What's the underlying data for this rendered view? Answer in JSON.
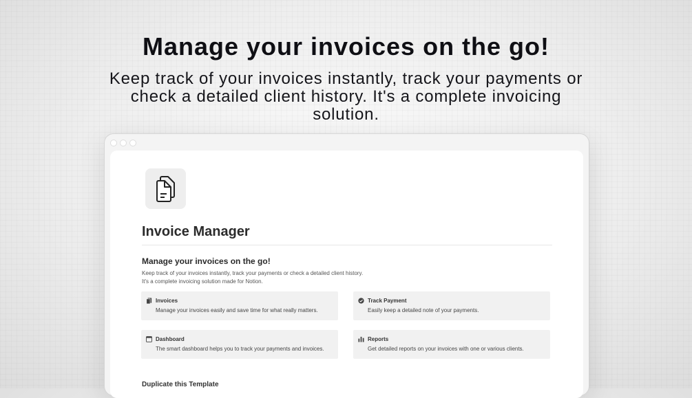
{
  "hero": {
    "title": "Manage your invoices on the go!",
    "subtitle": "Keep track of your invoices instantly, track your payments or check a detailed client history. It's a complete invoicing solution."
  },
  "page": {
    "icon": "document-copy-icon",
    "title": "Invoice Manager",
    "section_heading": "Manage your invoices on the go!",
    "description_line1": "Keep track of your invoices instantly, track your payments or check a detailed client history.",
    "description_line2": "It's a complete invoicing solution made for Notion.",
    "cards": [
      {
        "icon": "pages-icon",
        "title": "Invoices",
        "text": "Manage your invoices easily and save time for what really matters."
      },
      {
        "icon": "check-circle-icon",
        "title": "Track Payment",
        "text": "Easily keep a detailed note of your payments."
      },
      {
        "icon": "browser-window-icon",
        "title": "Dashboard",
        "text": "The smart dashboard helps you to track your payments and invoices."
      },
      {
        "icon": "bar-chart-icon",
        "title": "Reports",
        "text": "Get detailed reports on your invoices with one or various clients."
      }
    ],
    "duplicate_label": "Duplicate this Template"
  }
}
